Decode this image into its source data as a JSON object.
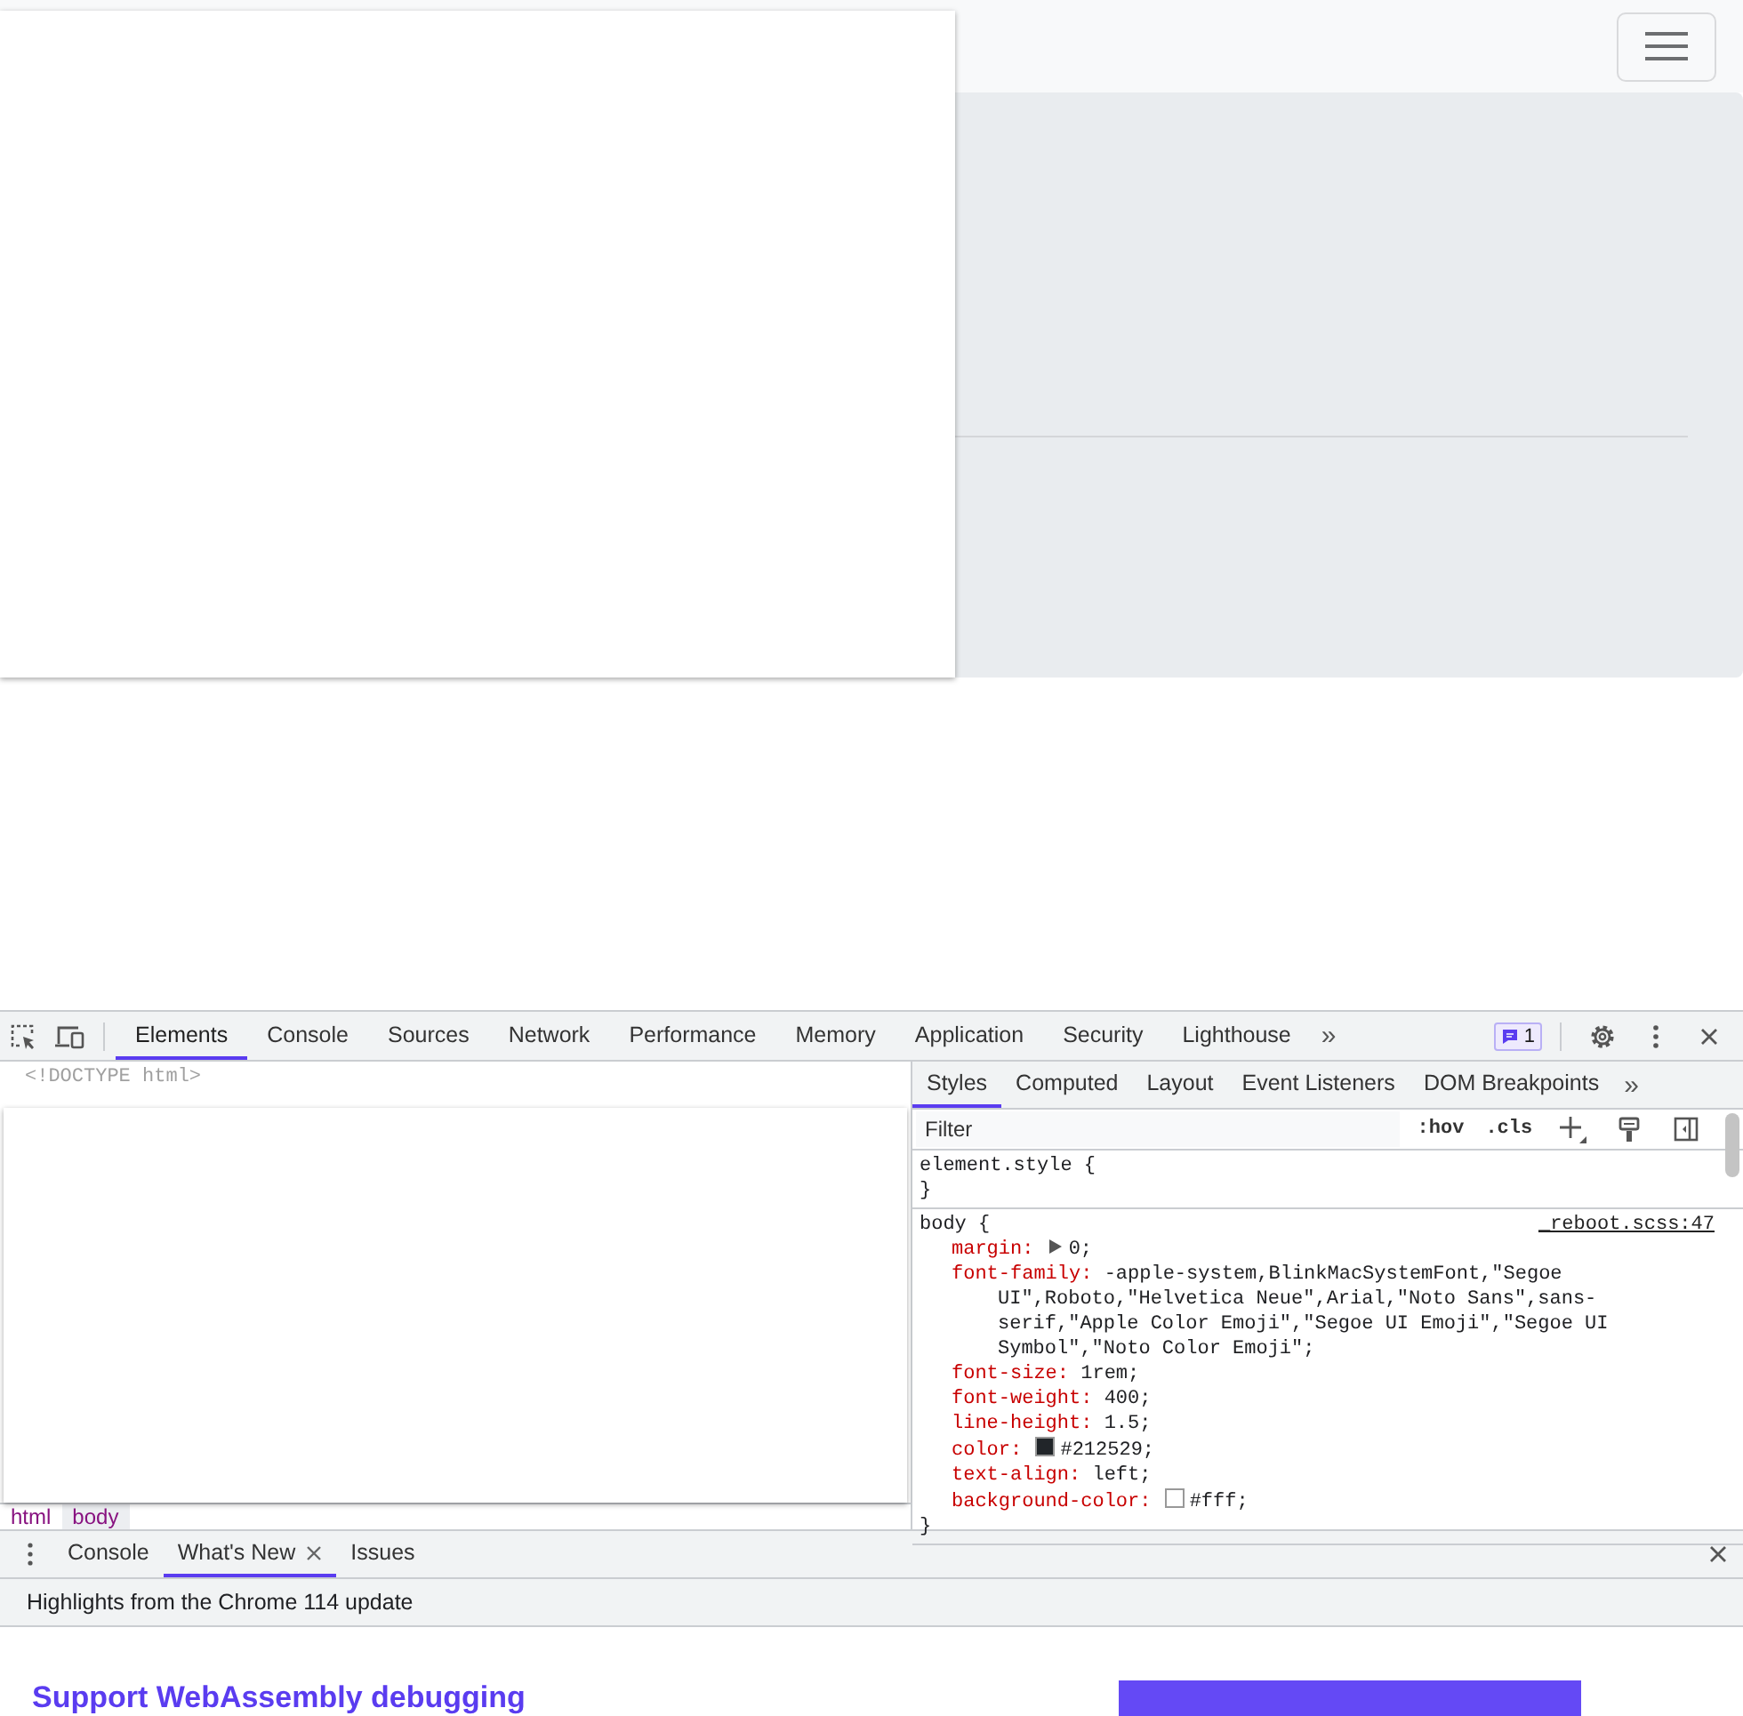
{
  "devtools": {
    "tabs": [
      {
        "label": "Elements",
        "selected": true
      },
      {
        "label": "Console",
        "selected": false
      },
      {
        "label": "Sources",
        "selected": false
      },
      {
        "label": "Network",
        "selected": false
      },
      {
        "label": "Performance",
        "selected": false
      },
      {
        "label": "Memory",
        "selected": false
      },
      {
        "label": "Application",
        "selected": false
      },
      {
        "label": "Security",
        "selected": false
      },
      {
        "label": "Lighthouse",
        "selected": false
      }
    ],
    "more_tabs": "»",
    "issues_badge": "1",
    "elements": {
      "doctype": "<!DOCTYPE html>",
      "breadcrumbs": [
        {
          "label": "html",
          "selected": false
        },
        {
          "label": "body",
          "selected": true
        }
      ]
    },
    "styles_tabs": [
      {
        "label": "Styles",
        "selected": true
      },
      {
        "label": "Computed",
        "selected": false
      },
      {
        "label": "Layout",
        "selected": false
      },
      {
        "label": "Event Listeners",
        "selected": false
      },
      {
        "label": "DOM Breakpoints",
        "selected": false
      }
    ],
    "styles_more": "»",
    "filter": {
      "placeholder": "Filter",
      "buttons": [
        ":hov",
        ".cls"
      ]
    },
    "rules": [
      {
        "selector": "element.style {",
        "close": "}"
      },
      {
        "selector": "body {",
        "source": "_reboot.scss:47",
        "close": "}",
        "declarations": [
          {
            "property": "margin:",
            "value": "0;",
            "expandable": true
          },
          {
            "property": "font-family:",
            "value": "-apple-system,BlinkMacSystemFont,\"Segoe UI\",Roboto,\"Helvetica Neue\",Arial,\"Noto Sans\",sans-serif,\"Apple Color Emoji\",\"Segoe UI Emoji\",\"Segoe UI Symbol\",\"Noto Color Emoji\";",
            "expandable": false
          },
          {
            "property": "font-size:",
            "value": "1rem;",
            "expandable": false
          },
          {
            "property": "font-weight:",
            "value": "400;",
            "expandable": false
          },
          {
            "property": "line-height:",
            "value": "1.5;",
            "expandable": false
          },
          {
            "property": "color:",
            "value": "#212529;",
            "kind": "color",
            "expandable": false
          },
          {
            "property": "text-align:",
            "value": "left;",
            "expandable": false
          },
          {
            "property": "background-color:",
            "value": "#fff;",
            "kind": "color",
            "expandable": false
          }
        ]
      }
    ]
  },
  "drawer": {
    "tabs": [
      {
        "label": "Console",
        "selected": false,
        "closable": false
      },
      {
        "label": "What's New",
        "selected": true,
        "closable": true
      },
      {
        "label": "Issues",
        "selected": false,
        "closable": false
      }
    ],
    "banner": "Highlights from the Chrome 114 update",
    "heading": "Support WebAssembly debugging"
  }
}
